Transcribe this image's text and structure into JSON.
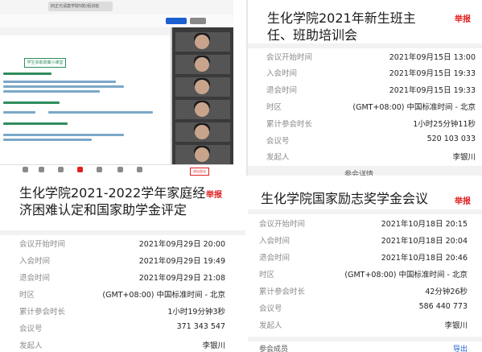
{
  "screenshot": {
    "tab_title": "四正元请案学院5款(组训班",
    "slide_heading": "学生资助政策小课堂",
    "toolbar_button": "退出会议"
  },
  "meetings": [
    {
      "title": "生化学院2021年新生班主任、班助培训会",
      "report": "举报",
      "rows": [
        {
          "key": "会议开始时间",
          "value": "2021年09月15日 13:00"
        },
        {
          "key": "入会时间",
          "value": "2021年09月15日 19:33"
        },
        {
          "key": "退会时间",
          "value": "2021年09月15日 19:33"
        },
        {
          "key": "时区",
          "value": "(GMT+08:00) 中国标准时间 - 北京"
        },
        {
          "key": "累计参会时长",
          "value": "1小时25分钟11秒"
        },
        {
          "key": "会议号",
          "value": "520 103 033"
        },
        {
          "key": "发起人",
          "value": "李银川"
        }
      ],
      "footer_cut": "参会详情"
    },
    {
      "title": "生化学院2021-2022学年家庭经济困难认定和国家助学金评定",
      "report": "举报",
      "rows": [
        {
          "key": "会议开始时间",
          "value": "2021年09月29日 20:00"
        },
        {
          "key": "入会时间",
          "value": "2021年09月29日 19:49"
        },
        {
          "key": "退会时间",
          "value": "2021年09月29日 21:08"
        },
        {
          "key": "时区",
          "value": "(GMT+08:00) 中国标准时间 - 北京"
        },
        {
          "key": "累计参会时长",
          "value": "1小时19分钟3秒"
        },
        {
          "key": "会议号",
          "value": "371 343 547"
        },
        {
          "key": "发起人",
          "value": "李银川"
        }
      ]
    },
    {
      "title": "生化学院国家励志奖学金会议",
      "report": "举报",
      "rows": [
        {
          "key": "会议开始时间",
          "value": "2021年10月18日 20:15"
        },
        {
          "key": "入会时间",
          "value": "2021年10月18日 20:04"
        },
        {
          "key": "退会时间",
          "value": "2021年10月18日 20:46"
        },
        {
          "key": "时区",
          "value": "(GMT+08:00) 中国标准时间 - 北京"
        },
        {
          "key": "累计参会时长",
          "value": "42分钟26秒"
        },
        {
          "key": "会议号",
          "value": "586 440 773"
        },
        {
          "key": "发起人",
          "value": "李银川"
        }
      ],
      "footer_cut": "参会成员",
      "footer_link": "导出"
    }
  ],
  "colors": {
    "report": "#e02020",
    "label": "#8a8a8a",
    "value": "#222222",
    "link": "#1b5fd0"
  }
}
